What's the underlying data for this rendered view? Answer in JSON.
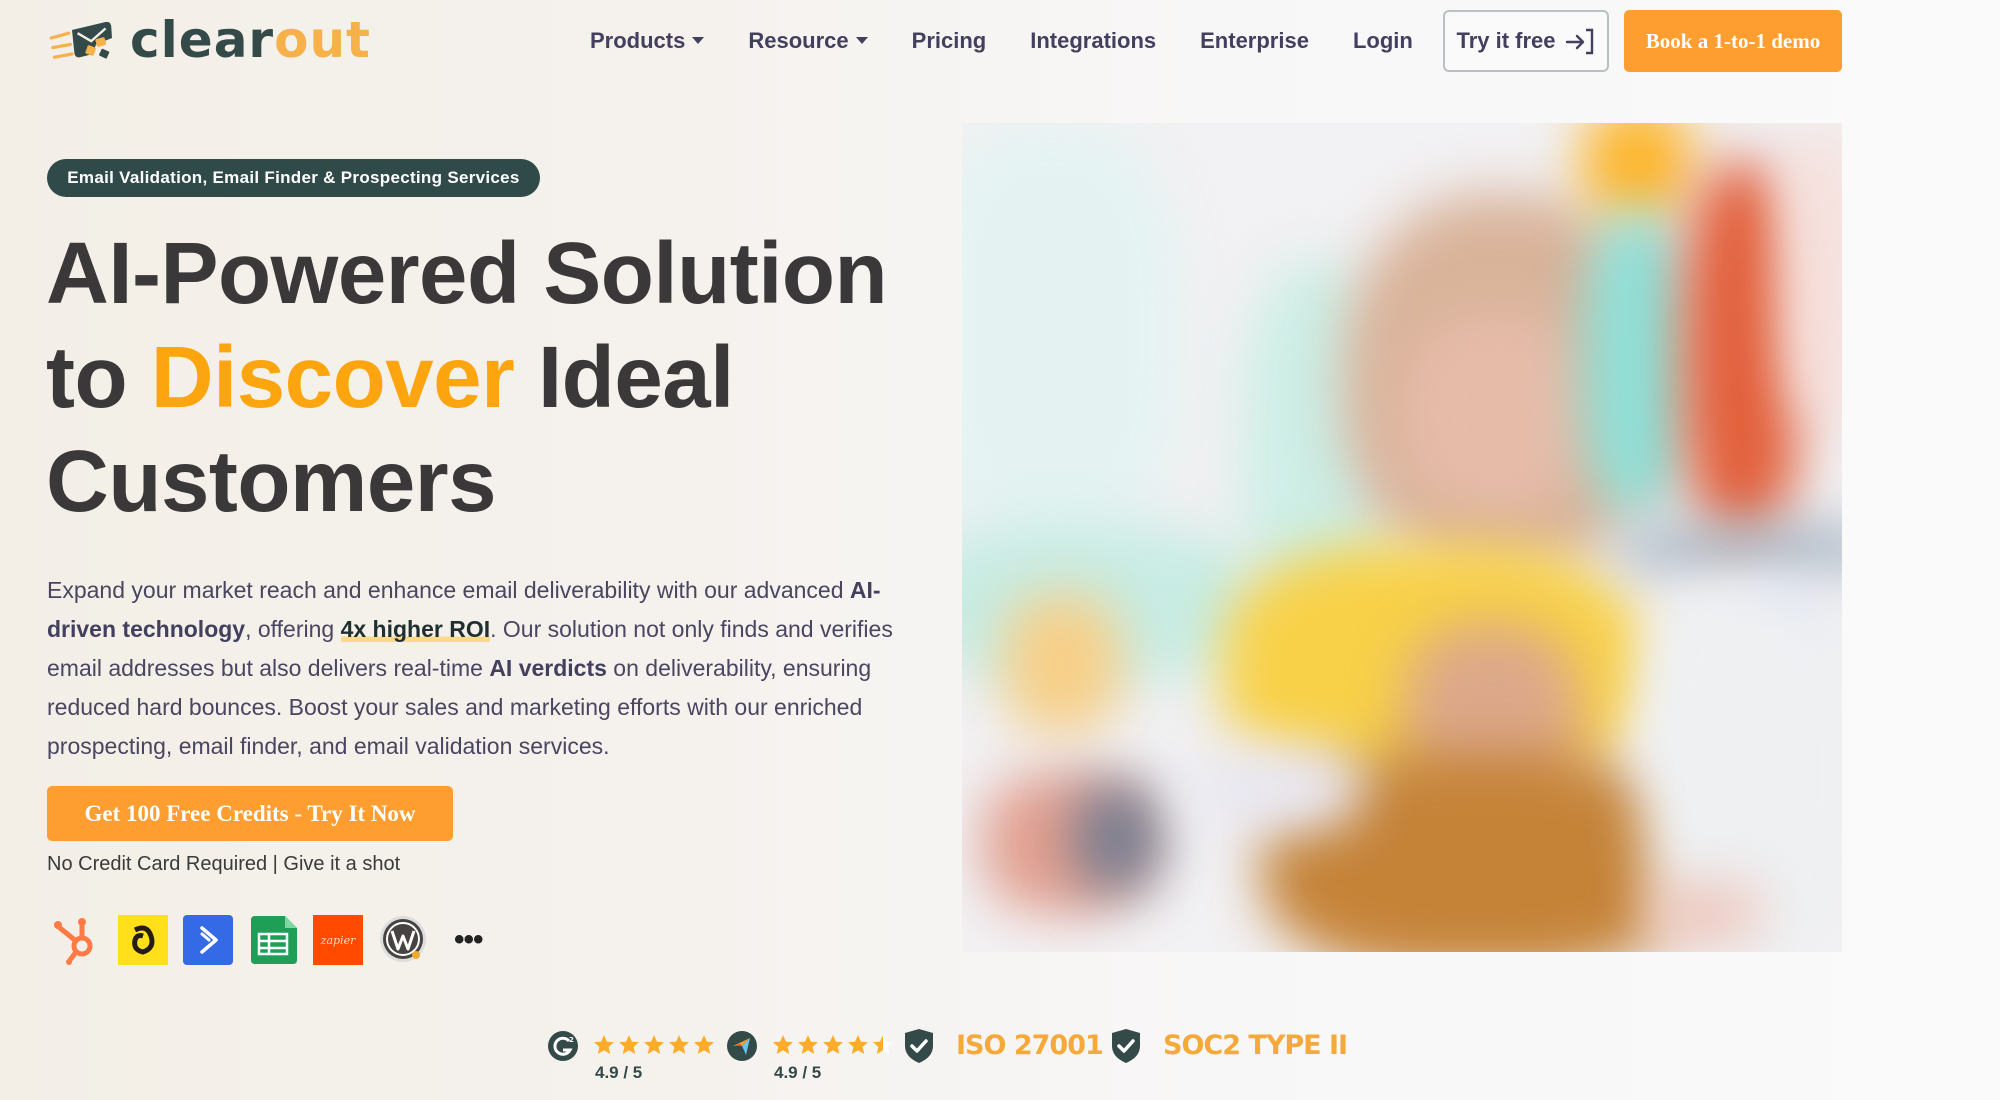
{
  "brand": {
    "name_part1": "clear",
    "name_part2": "out",
    "primary_color": "#344a48",
    "accent_color": "#f7b14a",
    "button_color": "#fe9e31"
  },
  "nav": {
    "items": [
      {
        "label": "Products",
        "has_dropdown": true
      },
      {
        "label": "Resource",
        "has_dropdown": true
      },
      {
        "label": "Pricing",
        "has_dropdown": false
      },
      {
        "label": "Integrations",
        "has_dropdown": false
      },
      {
        "label": "Enterprise",
        "has_dropdown": false
      },
      {
        "label": "Login",
        "has_dropdown": false
      }
    ],
    "try_free_label": "Try it free",
    "try_free_icon": "sign-in-arrow-icon",
    "demo_label": "Book a 1-to-1 demo"
  },
  "hero": {
    "badge": "Email Validation, Email Finder & Prospecting Services",
    "headline": {
      "line1": "AI-Powered Solution",
      "line2_pre": "to ",
      "line2_accent": "Discover",
      "line2_post": " Ideal",
      "line3": "Customers"
    },
    "paragraph": {
      "p1": "Expand your market reach and enhance email deliverability with our advanced ",
      "b1": "AI-driven technology",
      "p2": ", offering ",
      "hl": "4x higher ROI",
      "p3": ". Our solution not only finds and verifies email addresses but also delivers real-time ",
      "b2": "AI verdicts",
      "p4": " on deliverability, ensuring reduced hard bounces. Boost your sales and marketing efforts with our enriched prospecting, email finder, and email validation services."
    },
    "cta_label": "Get 100 Free Credits - Try It Now",
    "subtext_1": "No Credit Card Required",
    "subtext_sep": " | ",
    "subtext_2": "Give it a shot",
    "integrations": [
      {
        "name": "HubSpot",
        "icon": "hubspot-icon"
      },
      {
        "name": "Mailchimp",
        "icon": "mailchimp-icon"
      },
      {
        "name": "ActiveCampaign",
        "icon": "activecampaign-icon"
      },
      {
        "name": "Google Sheets",
        "icon": "google-sheets-icon"
      },
      {
        "name": "Zapier",
        "icon": "zapier-icon",
        "text": "zapier"
      },
      {
        "name": "WordPress",
        "icon": "wordpress-icon"
      }
    ],
    "more_label": "•••"
  },
  "trust": {
    "ratings": [
      {
        "platform": "G2",
        "icon": "g2-icon",
        "stars": 5,
        "score": "4.9 / 5"
      },
      {
        "platform": "Capterra",
        "icon": "capterra-icon",
        "stars": 4.5,
        "score": "4.9 / 5"
      }
    ],
    "certifications": [
      {
        "label": "ISO 27001",
        "icon": "shield-check-icon"
      },
      {
        "label": "SOC2 TYPE II",
        "icon": "shield-check-icon"
      }
    ]
  }
}
